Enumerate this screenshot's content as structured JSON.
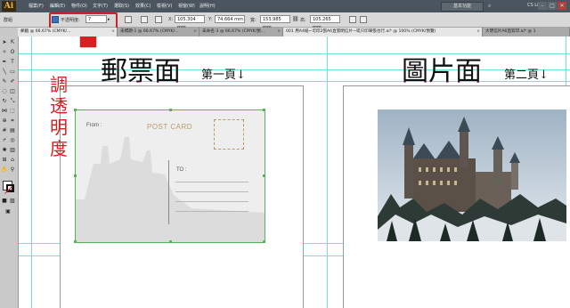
{
  "app": {
    "logo": "Ai",
    "menus": [
      "檔案(F)",
      "編輯(E)",
      "物件(O)",
      "文字(T)",
      "選取(S)",
      "效果(C)",
      "檢視(V)",
      "視窗(W)",
      "說明(H)"
    ],
    "workspace": "基本功能",
    "cs_live": "CS Live",
    "window_controls": [
      "–",
      "□",
      "✕"
    ]
  },
  "controlbar": {
    "selection_label": "群組",
    "opacity_label": "不透明度:",
    "opacity_value": "7",
    "x_label": "X:",
    "x_value": "105.304 mm",
    "y_label": "Y:",
    "y_value": "74.664 mm",
    "w_label": "寬:",
    "w_value": "153.985 mm",
    "h_label": "高:",
    "h_value": "105.265 mm"
  },
  "tabs": [
    "郵戳 @ 66.67% (CMYK/...",
    "未標題-1 @ 66.67% (CMYK/...",
    "未命名-3 @ 66.67% (CMYK/預...",
    "001 用A4紙~可印2張A6直張明信片~或只印單張也行.ai* @ 100% (CMYK/預覽)",
    "大明信片A6直寫印.ai* @ 1"
  ],
  "annotation": {
    "text": [
      "調",
      "透",
      "明",
      "度"
    ],
    "color": "#d42020"
  },
  "pages": {
    "left_title": "郵票面",
    "left_subtitle": "第一頁↓",
    "right_title": "圖片面",
    "right_subtitle": "第二頁↓"
  },
  "postcard": {
    "from_label": "From :",
    "heading": "POST CARD",
    "to_label": "TO :"
  },
  "colors": {
    "guide": "#6fe2e2",
    "annotation": "#d42020",
    "selection": "#56b356"
  }
}
